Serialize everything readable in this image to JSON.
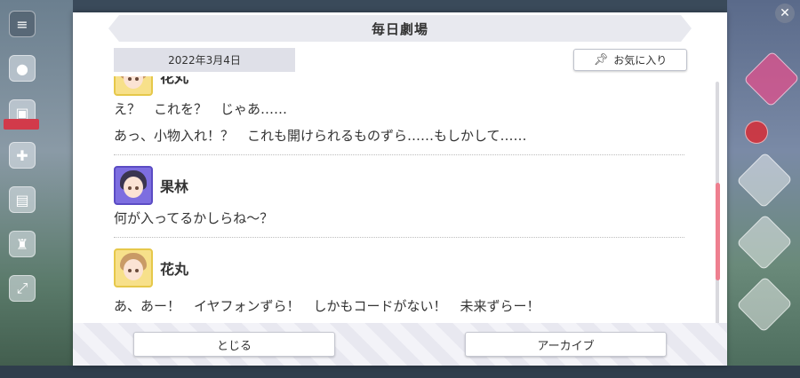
{
  "title": "毎日劇場",
  "date": "2022年3月4日",
  "favorite_label": "お気に入り",
  "entries": [
    {
      "speaker": "花丸",
      "lines": [
        "え？　これを？　じゃあ……",
        "あっ、小物入れ！？　これも開けられるものずら……もしかして……"
      ]
    },
    {
      "speaker": "果林",
      "lines": [
        "何が入ってるかしらね～？"
      ]
    },
    {
      "speaker": "花丸",
      "lines": [
        "あ、あー！　イヤフォンずら！　しかもコードがない！　未来ずらー！"
      ]
    }
  ],
  "buttons": {
    "close": "とじる",
    "archive": "アーカイブ"
  },
  "colors": {
    "scroll_thumb": "#ee7f8f",
    "title_bar": "#e8e9ef",
    "date_pill": "#dfe0e8"
  },
  "icons": {
    "favorite": "pin-icon",
    "close": "close-icon"
  }
}
